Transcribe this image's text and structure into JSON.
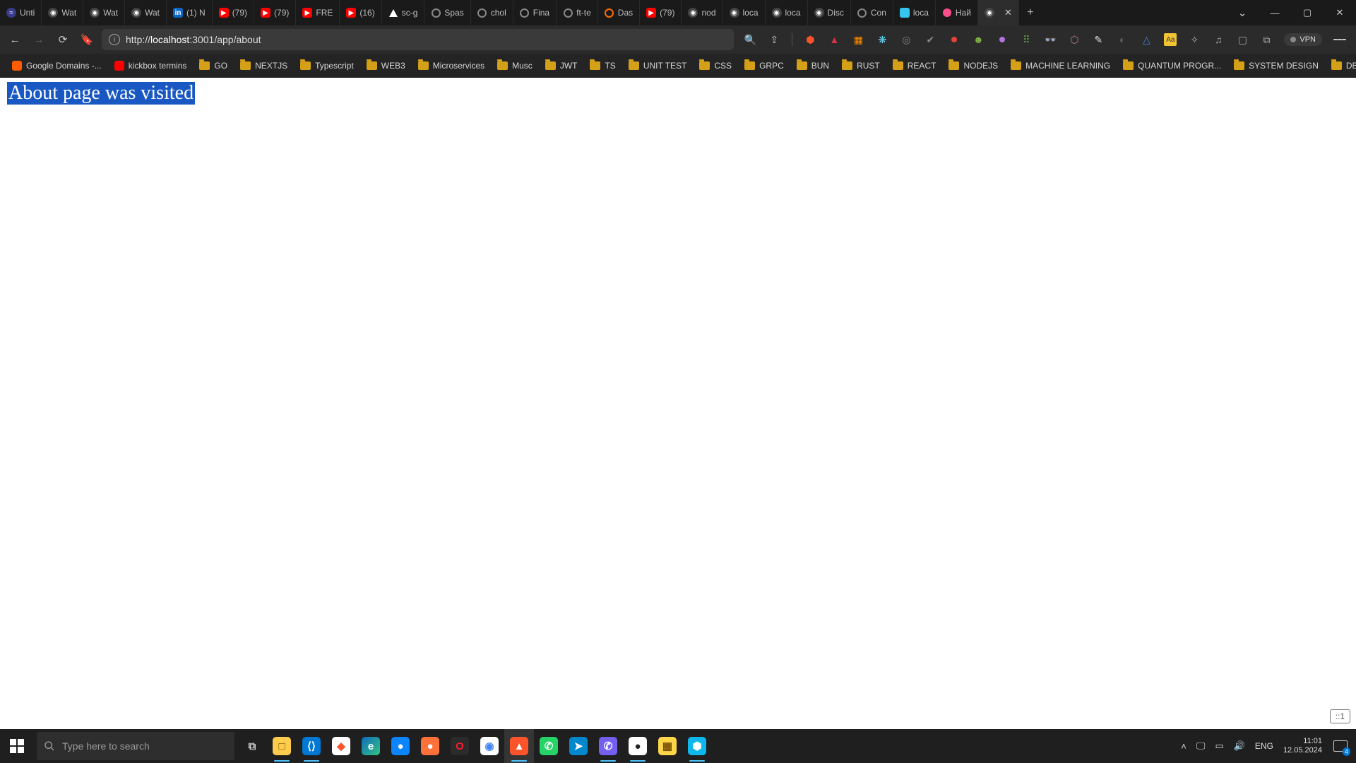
{
  "tabs": [
    {
      "label": "Unti",
      "icon": "co"
    },
    {
      "label": "Wat",
      "icon": "gl"
    },
    {
      "label": "Wat",
      "icon": "gl"
    },
    {
      "label": "Wat",
      "icon": "gl"
    },
    {
      "label": "(1) N",
      "icon": "in"
    },
    {
      "label": "(79)",
      "icon": "yt"
    },
    {
      "label": "(79)",
      "icon": "yt"
    },
    {
      "label": "FRE",
      "icon": "yt"
    },
    {
      "label": "(16)",
      "icon": "yt"
    },
    {
      "label": "sc-g",
      "icon": "tri"
    },
    {
      "label": "Spas",
      "icon": "ring"
    },
    {
      "label": "chol",
      "icon": "ring"
    },
    {
      "label": "Fina",
      "icon": "ring"
    },
    {
      "label": "ft-te",
      "icon": "ring"
    },
    {
      "label": "Das",
      "icon": "dash"
    },
    {
      "label": "(79)",
      "icon": "yt"
    },
    {
      "label": "nod",
      "icon": "gl"
    },
    {
      "label": "loca",
      "icon": "gl"
    },
    {
      "label": "loca",
      "icon": "gl"
    },
    {
      "label": "Disc",
      "icon": "gl"
    },
    {
      "label": "Con",
      "icon": "ring"
    },
    {
      "label": "loca",
      "icon": "sl"
    },
    {
      "label": "Най",
      "icon": "pk"
    },
    {
      "label": "",
      "icon": "gl",
      "active": true
    }
  ],
  "url": {
    "prefix": "http://",
    "host": "localhost",
    "rest": ":3001/app/about"
  },
  "addr_icons": {
    "zoom": "search-icon",
    "share": "share-icon",
    "shield": "brave-shield-icon",
    "warn": "warning-icon",
    "ext1": "extension-icon",
    "ext2": "react-devtools-icon",
    "ext3": "target-icon",
    "ext4": "check-icon",
    "ext5": "adblock-icon",
    "ext6": "frog-icon",
    "ext7": "purple-dot-icon",
    "ext8": "grid-icon",
    "ext9": "glasses-icon",
    "ext10": "hex-icon",
    "ext11": "eyedropper-icon",
    "ext12": "toggle-icon",
    "ext13": "triangle-icon",
    "ext14": "aa-icon",
    "ext15": "puzzle-icon",
    "ext16": "music-icon",
    "ext17": "square-icon",
    "ext18": "pip-icon",
    "vpn": "VPN"
  },
  "bookmarks": [
    {
      "label": "Google Domains -...",
      "type": "link",
      "color": "#ff5c00"
    },
    {
      "label": "kickbox termins",
      "type": "link",
      "color": "#ff0000"
    },
    {
      "label": "GO",
      "type": "folder"
    },
    {
      "label": "NEXTJS",
      "type": "folder"
    },
    {
      "label": "Typescript",
      "type": "folder"
    },
    {
      "label": "WEB3",
      "type": "folder"
    },
    {
      "label": "Microservices",
      "type": "folder"
    },
    {
      "label": "Musc",
      "type": "folder"
    },
    {
      "label": "JWT",
      "type": "folder"
    },
    {
      "label": "TS",
      "type": "folder"
    },
    {
      "label": "UNIT TEST",
      "type": "folder"
    },
    {
      "label": "CSS",
      "type": "folder"
    },
    {
      "label": "GRPC",
      "type": "folder"
    },
    {
      "label": "BUN",
      "type": "folder"
    },
    {
      "label": "RUST",
      "type": "folder"
    },
    {
      "label": "REACT",
      "type": "folder"
    },
    {
      "label": "NODEJS",
      "type": "folder"
    },
    {
      "label": "MACHINE LEARNING",
      "type": "folder"
    },
    {
      "label": "QUANTUM PROGR...",
      "type": "folder"
    },
    {
      "label": "SYSTEM DESIGN",
      "type": "folder"
    },
    {
      "label": "DB",
      "type": "folder"
    }
  ],
  "page": {
    "heading": "About page was visited",
    "badge": "::1"
  },
  "taskbar": {
    "search_placeholder": "Type here to search",
    "apps": [
      {
        "name": "task-view-icon",
        "bg": "transparent",
        "fg": "#ccc",
        "glyph": "⧉"
      },
      {
        "name": "file-explorer-icon",
        "bg": "#ffcc4d",
        "fg": "#7a5200",
        "glyph": "□",
        "running": true
      },
      {
        "name": "vscode-icon",
        "bg": "#0078d4",
        "fg": "#fff",
        "glyph": "⟨⟩",
        "running": true
      },
      {
        "name": "brave-alt-icon",
        "bg": "#fff",
        "fg": "#fb542b",
        "glyph": "◆"
      },
      {
        "name": "edge-icon",
        "bg": "linear-gradient(135deg,#0f6cbd,#33c481)",
        "fg": "#fff",
        "glyph": "e"
      },
      {
        "name": "firefox-dev-icon",
        "bg": "#0a84ff",
        "fg": "#fff",
        "glyph": "●"
      },
      {
        "name": "firefox-icon",
        "bg": "#ff7139",
        "fg": "#fff",
        "glyph": "●"
      },
      {
        "name": "opera-icon",
        "bg": "#2b2b2b",
        "fg": "#ff1b2d",
        "glyph": "O"
      },
      {
        "name": "chrome-icon",
        "bg": "#fff",
        "fg": "#4285f4",
        "glyph": "◉"
      },
      {
        "name": "brave-icon",
        "bg": "#fb542b",
        "fg": "#fff",
        "glyph": "▲",
        "running": true,
        "active": true
      },
      {
        "name": "whatsapp-icon",
        "bg": "#25d366",
        "fg": "#fff",
        "glyph": "✆"
      },
      {
        "name": "telegram-icon",
        "bg": "#0088cc",
        "fg": "#fff",
        "glyph": "➤"
      },
      {
        "name": "viber-icon",
        "bg": "#7360f2",
        "fg": "#fff",
        "glyph": "✆",
        "running": true
      },
      {
        "name": "obs-icon",
        "bg": "#fff",
        "fg": "#222",
        "glyph": "●",
        "running": true
      },
      {
        "name": "sticky-notes-icon",
        "bg": "#ffd54a",
        "fg": "#7a5200",
        "glyph": "▦"
      },
      {
        "name": "docker-icon",
        "bg": "#0db7ed",
        "fg": "#fff",
        "glyph": "⬢",
        "running": true
      }
    ],
    "lang": "ENG",
    "time": "11:01",
    "date": "12.05.2024",
    "notif_count": "4"
  }
}
